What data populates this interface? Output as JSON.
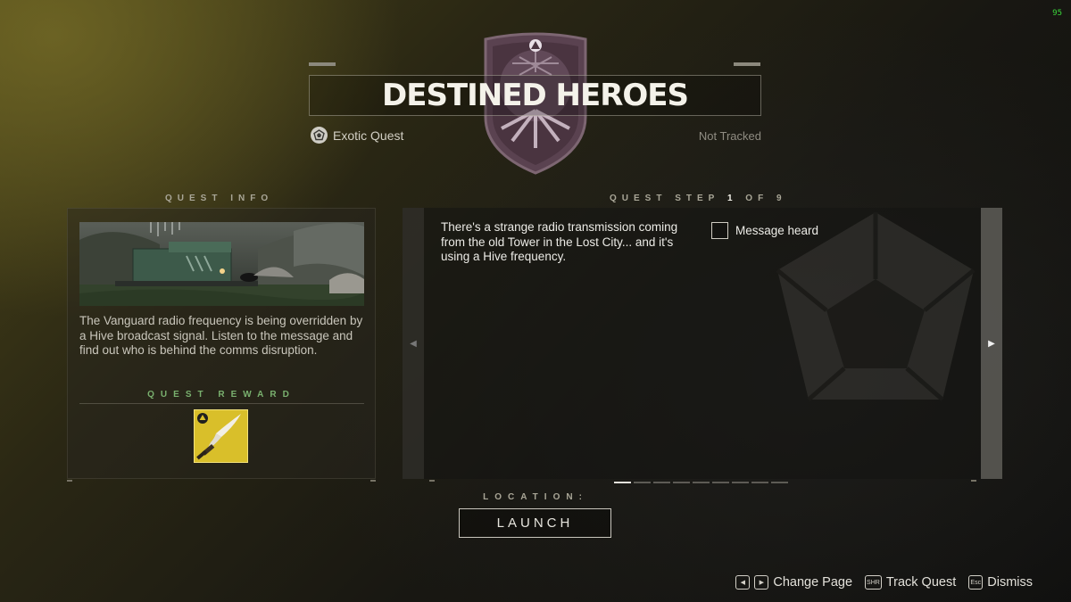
{
  "fps": "95",
  "header": {
    "title": "DESTINED HEROES",
    "quest_type": "Exotic Quest",
    "tracking_status": "Not Tracked"
  },
  "quest_info": {
    "section_label": "QUEST INFO",
    "description": "The Vanguard radio frequency is being overridden by a Hive broadcast signal. Listen to the message and find out who is behind the comms disruption.",
    "reward_label": "QUEST REWARD"
  },
  "quest_step": {
    "label_prefix": "QUEST STEP",
    "current": "1",
    "of_label": "OF",
    "total": "9",
    "text": "There's a strange radio transmission coming from the old Tower in the Lost City... and it's using a Hive frequency.",
    "objective": "Message heard",
    "pages": 9,
    "active_page": 1
  },
  "location": {
    "label": "LOCATION:",
    "button": "LAUNCH"
  },
  "footer": {
    "change_page": "Change Page",
    "track_quest": "Track Quest",
    "track_key": "SHR",
    "dismiss": "Dismiss",
    "dismiss_key": "Esc"
  },
  "icons": {
    "quest_type": "ghost-shell-icon",
    "reward": "exotic-sword-icon",
    "nav_left": "chevron-left-icon",
    "nav_right": "chevron-right-icon"
  },
  "colors": {
    "reward_label": "#79b06e",
    "exotic": "#d9bf2a"
  }
}
